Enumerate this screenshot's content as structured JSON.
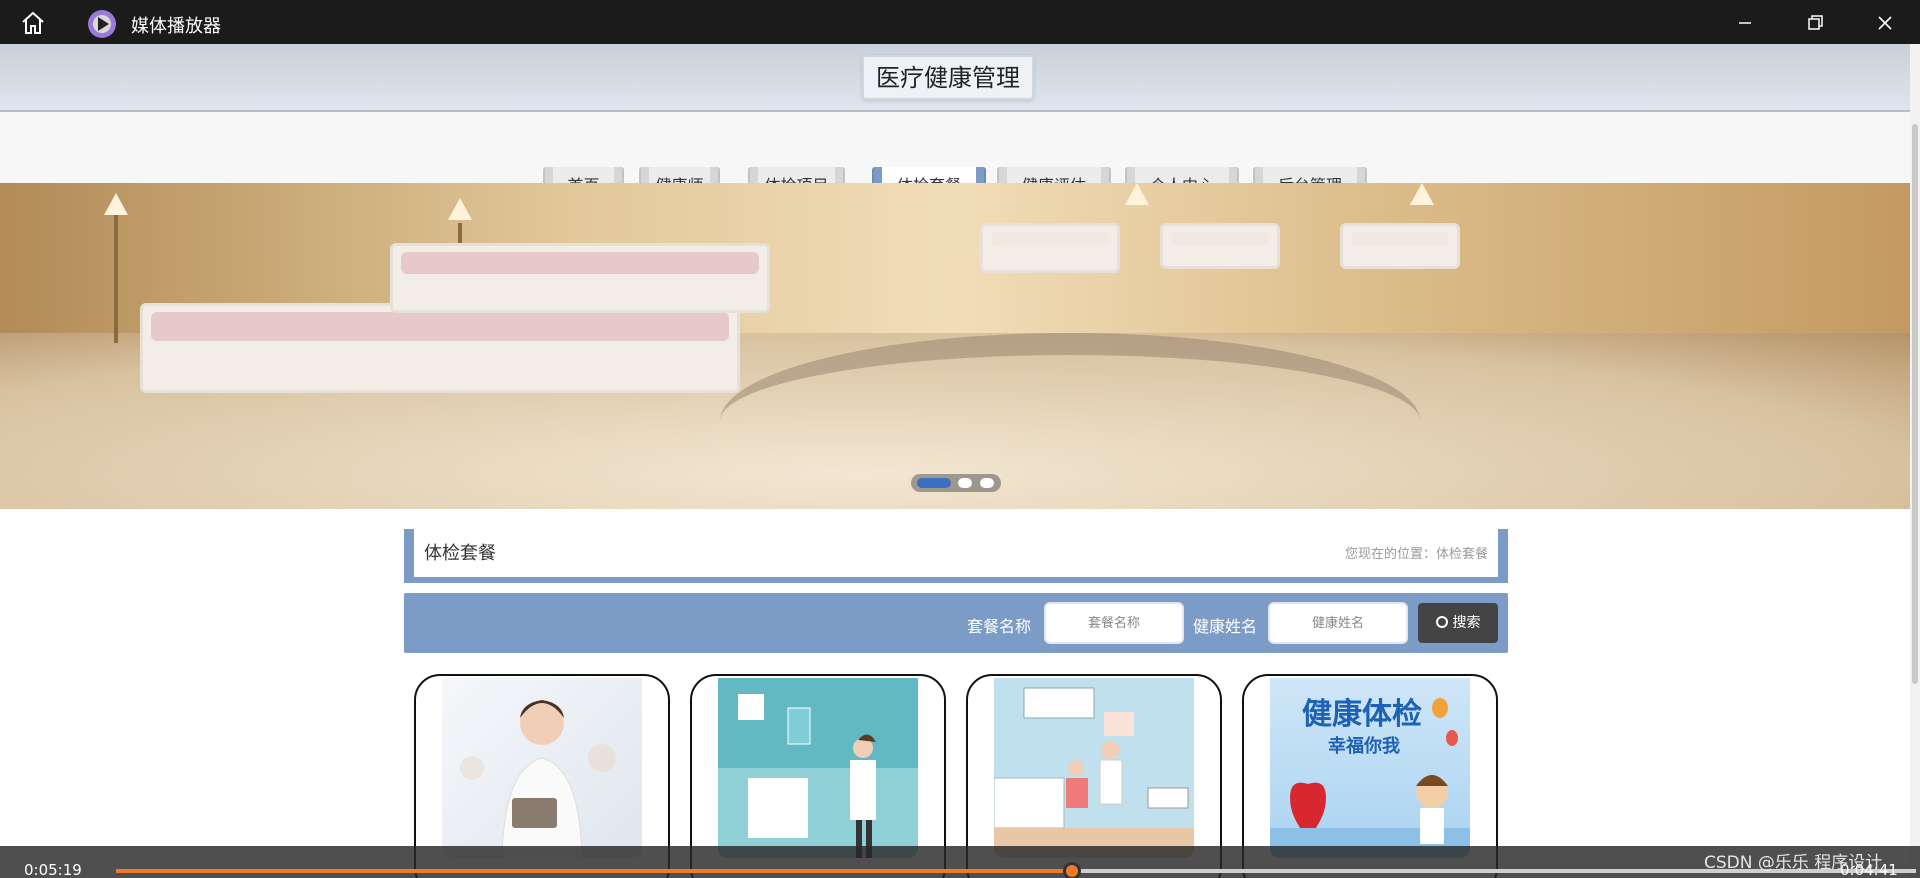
{
  "window": {
    "title": "媒体播放器",
    "icons": {
      "home": "home-icon",
      "app": "media-player-icon",
      "minimize": "minimize-icon",
      "maximize": "restore-icon",
      "close": "close-icon"
    }
  },
  "site": {
    "title": "医疗健康管理"
  },
  "nav": {
    "items": [
      {
        "label": "首页"
      },
      {
        "label": "健康师"
      },
      {
        "label": "体检项目"
      },
      {
        "label": "体检套餐"
      },
      {
        "label": "健康评估"
      },
      {
        "label": "个人中心"
      },
      {
        "label": "后台管理"
      }
    ],
    "active": "体检套餐"
  },
  "banner": {
    "slides": 3,
    "active_slide": 1
  },
  "breadcrumb": {
    "title": "体检套餐",
    "location": "您现在的位置：体检套餐"
  },
  "search": {
    "fields": [
      {
        "label": "套餐名称",
        "placeholder": "套餐名称"
      },
      {
        "label": "健康姓名",
        "placeholder": "健康姓名"
      }
    ],
    "button": "搜索",
    "button_icon": "search-icon"
  },
  "cards": [
    {
      "image": "doctor-with-tablet"
    },
    {
      "image": "dentist-illustration"
    },
    {
      "image": "doctor-patient-illustration"
    },
    {
      "image": "health-checkup-poster",
      "poster_text": "健康体检",
      "poster_subtext": "幸福你我"
    }
  ],
  "player": {
    "elapsed": "0:05:19",
    "remaining": "0:04:41",
    "progress": 0.531
  },
  "watermark": "CSDN @乐乐 程序设计",
  "colors": {
    "accent": "#7c9cc7",
    "player_progress": "#f07a2a",
    "titlebar": "#1b1b1b"
  }
}
